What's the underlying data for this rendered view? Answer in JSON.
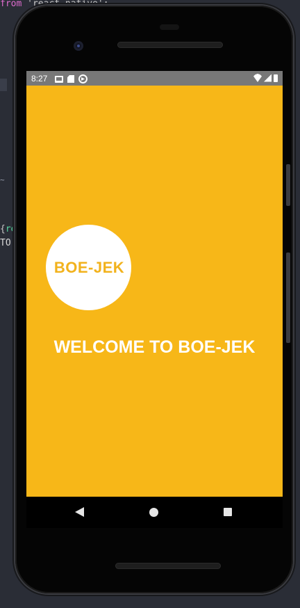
{
  "editor": {
    "line_from_keyword": "from",
    "line_from_string": " 'react-native';",
    "line_brace": "{",
    "line_brace_re": "re",
    "line_to": "TO",
    "line_tilde": "~"
  },
  "status_bar": {
    "time": "8:27",
    "left_icons": [
      "gmail-icon",
      "sd-card-icon",
      "sync-icon"
    ],
    "right_icons": [
      "wifi-icon",
      "signal-icon",
      "battery-icon"
    ],
    "background": "#787878"
  },
  "app": {
    "background": "#f7b718",
    "logo_text": "BOE-JEK",
    "welcome_text": "WELCOME TO BOE-JEK"
  },
  "nav_bar": {
    "buttons": [
      "back-icon",
      "home-icon",
      "recents-icon"
    ]
  }
}
